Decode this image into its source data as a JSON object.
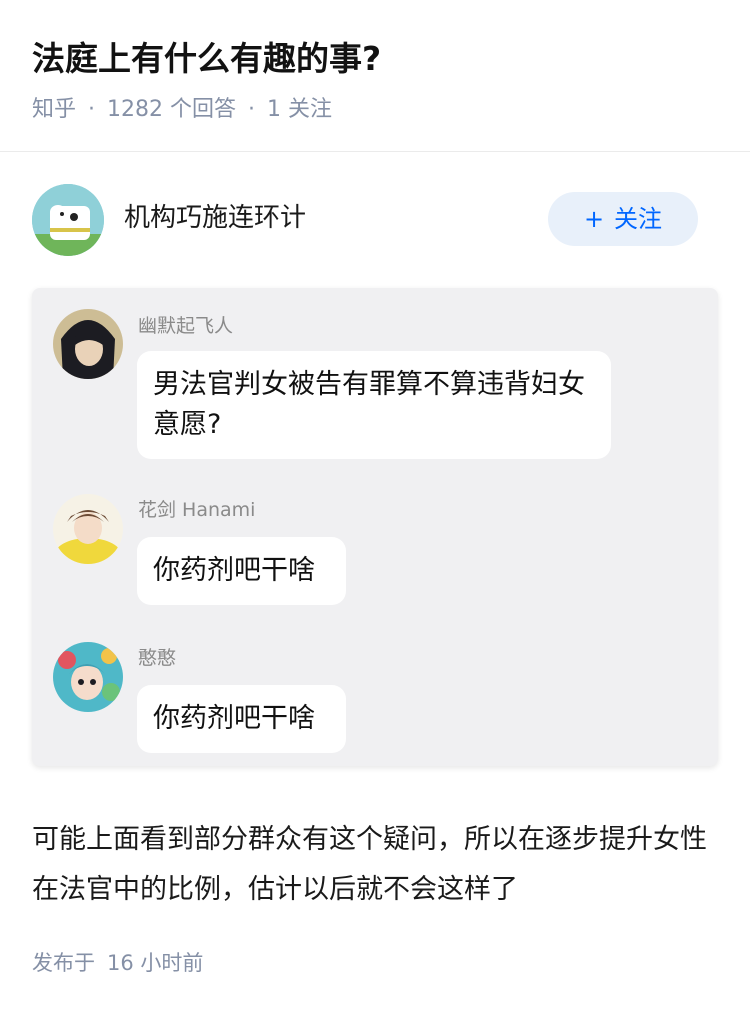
{
  "question": {
    "title": "法庭上有什么有趣的事?",
    "source": "知乎",
    "answer_count": "1282 个回答",
    "follow_count": "1 关注"
  },
  "author": {
    "name": "机构巧施连环计",
    "follow_plus": "+",
    "follow_label": "关注"
  },
  "chat": {
    "messages": [
      {
        "sender": "幽默起飞人",
        "text": "男法官判女被告有罪算不算违背妇女意愿?"
      },
      {
        "sender": "花剑 Hanami",
        "text": "你药剂吧干啥"
      },
      {
        "sender": "憨憨",
        "text": "你药剂吧干啥"
      }
    ]
  },
  "answer": {
    "text": "可能上面看到部分群众有这个疑问，所以在逐步提升女性在法官中的比例，估计以后就不会这样了",
    "published_label": "发布于",
    "published_time": "16 小时前"
  },
  "colors": {
    "accent": "#0066ff",
    "meta_gray": "#8590a6",
    "card_bg": "#f0f0f2"
  }
}
